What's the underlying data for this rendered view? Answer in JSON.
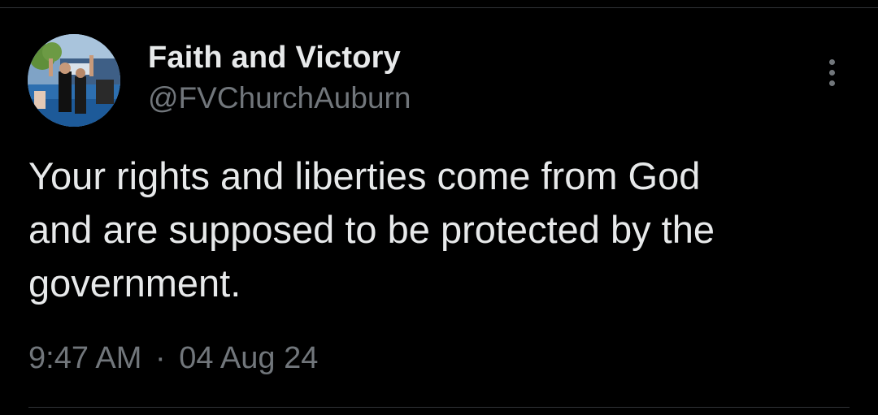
{
  "tweet": {
    "author": {
      "display_name": "Faith and Victory",
      "handle": "@FVChurchAuburn"
    },
    "text_lines": [
      "Your rights and liberties come from God",
      "and are supposed to be protected by the",
      "government."
    ],
    "time": "9:47 AM",
    "separator": "·",
    "date": "04 Aug 24"
  },
  "icons": {
    "more": "more-vertical-icon"
  },
  "colors": {
    "background": "#000000",
    "primary_text": "#e7e9ea",
    "secondary_text": "#71767b",
    "divider": "#2f3336"
  }
}
